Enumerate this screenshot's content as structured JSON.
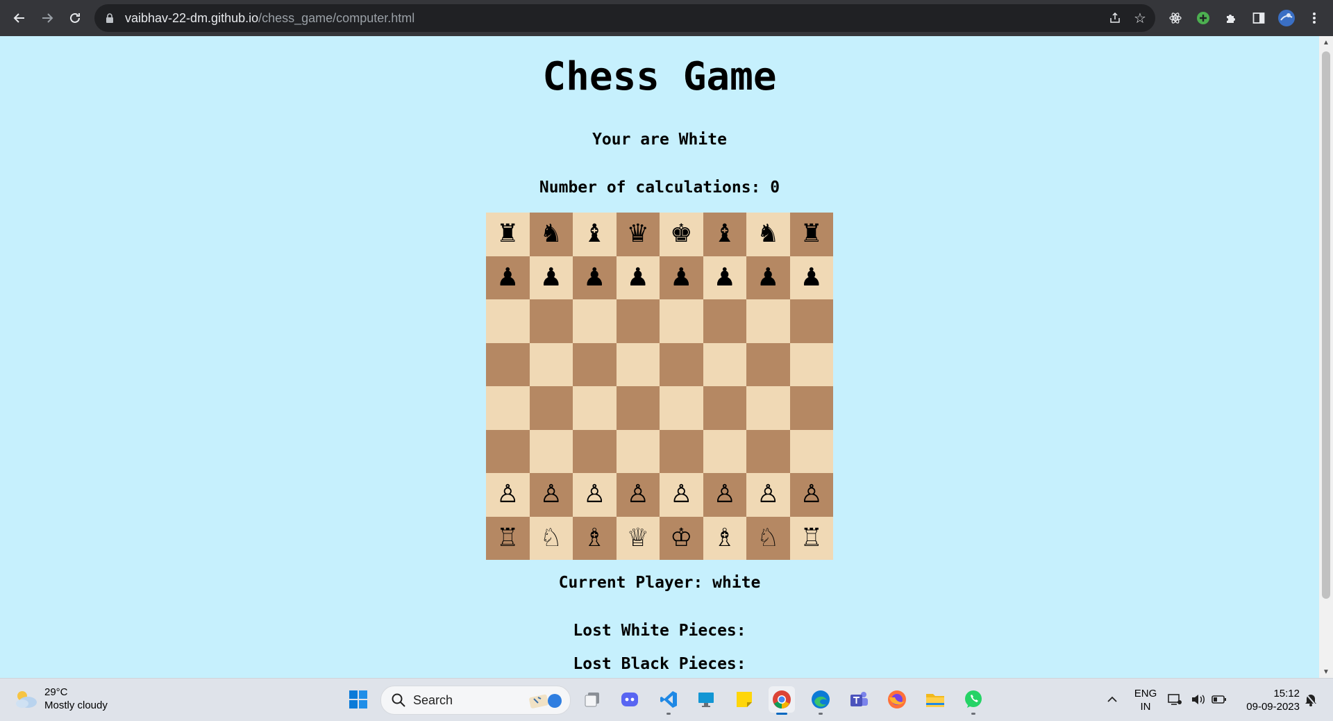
{
  "browser": {
    "url_domain": "vaibhav-22-dm.github.io",
    "url_path": "/chess_game/computer.html"
  },
  "page": {
    "title": "Chess Game",
    "player_color_text": "Your are White",
    "calculations_text": "Number of calculations: 0",
    "current_player_text": "Current Player: white",
    "lost_white_text": "Lost White Pieces:",
    "lost_black_text": "Lost Black Pieces:"
  },
  "board": {
    "rows": [
      [
        "♜",
        "♞",
        "♝",
        "♛",
        "♚",
        "♝",
        "♞",
        "♜"
      ],
      [
        "♟",
        "♟",
        "♟",
        "♟",
        "♟",
        "♟",
        "♟",
        "♟"
      ],
      [
        "",
        "",
        "",
        "",
        "",
        "",
        "",
        ""
      ],
      [
        "",
        "",
        "",
        "",
        "",
        "",
        "",
        ""
      ],
      [
        "",
        "",
        "",
        "",
        "",
        "",
        "",
        ""
      ],
      [
        "",
        "",
        "",
        "",
        "",
        "",
        "",
        ""
      ],
      [
        "♙",
        "♙",
        "♙",
        "♙",
        "♙",
        "♙",
        "♙",
        "♙"
      ],
      [
        "♖",
        "♘",
        "♗",
        "♕",
        "♔",
        "♗",
        "♘",
        "♖"
      ]
    ],
    "light_color": "#f0d9b5",
    "dark_color": "#b58863"
  },
  "taskbar": {
    "weather_temp": "29°C",
    "weather_desc": "Mostly cloudy",
    "search_label": "Search",
    "lang_line1": "ENG",
    "lang_line2": "IN",
    "time": "15:12",
    "date": "09-09-2023"
  },
  "colors": {
    "page_bg": "#c6f0fd",
    "chrome_bg": "#35363a"
  }
}
